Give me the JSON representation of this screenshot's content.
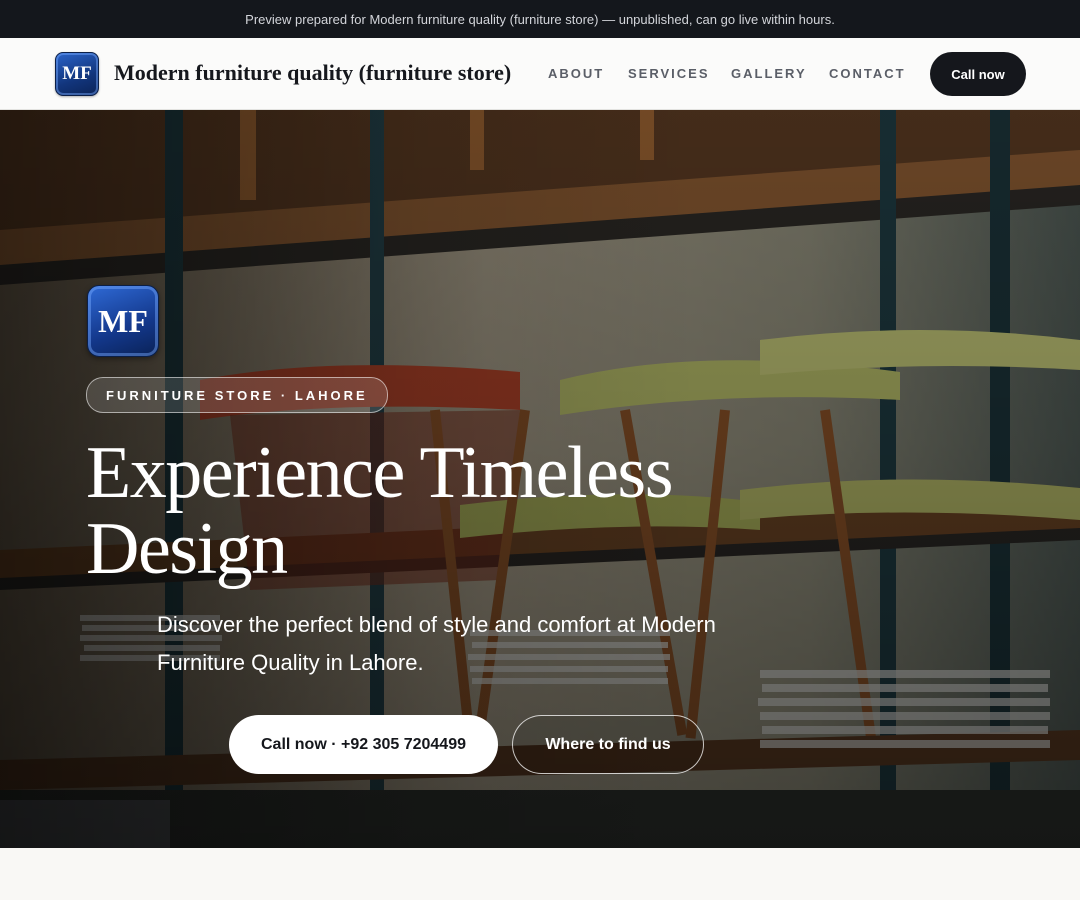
{
  "preview_banner": {
    "text": "Preview prepared for Modern furniture quality (furniture store) — unpublished, can go live within hours."
  },
  "header": {
    "logo_initials": "MF",
    "brand_name": "Modern furniture quality (furniture store)",
    "nav": [
      "ABOUT",
      "SERVICES",
      "GALLERY",
      "CONTACT"
    ],
    "cta_label": "Call now"
  },
  "hero": {
    "logo_initials": "MF",
    "badge": "FURNITURE STORE · LAHORE",
    "headline": "Experience Timeless Design",
    "subtitle": "Discover the perfect blend of style and comfort at Modern Furniture Quality in Lahore.",
    "primary_button": "Call now · +92 305 7204499",
    "secondary_button": "Where to find us",
    "background_image_subject": "wooden chairs with red and green seats on metal shelving with stacked magazines"
  },
  "colors": {
    "banner_bg": "#14171c",
    "nav_bg": "#fbfbfa",
    "accent_dark": "#15171c",
    "logo_blue": "#1a3f8f",
    "page_bg": "#f9f8f5"
  }
}
